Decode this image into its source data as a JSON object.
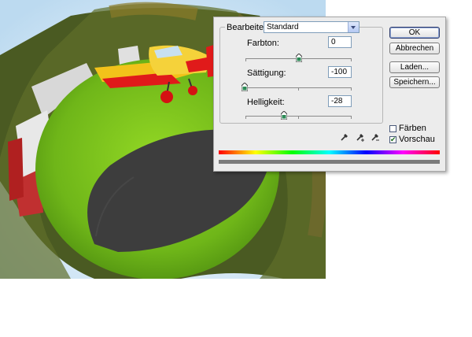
{
  "dialog": {
    "bearbeiten_label": "Bearbeiten:",
    "bearbeiten_value": "Standard",
    "farbton": {
      "label": "Farbton:",
      "value": "0",
      "slider_fraction": 0.5
    },
    "saettigung": {
      "label": "Sättigung:",
      "value": "-100",
      "slider_fraction": 0.0
    },
    "helligkeit": {
      "label": "Helligkeit:",
      "value": "-28",
      "slider_fraction": 0.36
    },
    "buttons": {
      "ok": "OK",
      "abbrechen": "Abbrechen",
      "laden": "Laden...",
      "speichern": "Speichern..."
    },
    "checkboxes": {
      "faerben": {
        "label": "Färben",
        "checked": false
      },
      "vorschau": {
        "label": "Vorschau",
        "checked": true
      }
    },
    "icons": [
      "eyedropper-icon",
      "eyedropper-plus-icon",
      "eyedropper-minus-icon"
    ]
  },
  "colors": {
    "grass": "#7cc41e",
    "sky": "#cfe6f5",
    "tarmac": "#3c3c3c",
    "plane_red": "#e01a1a",
    "plane_yellow": "#f2c21a",
    "accent_blue": "#7f9db9"
  }
}
